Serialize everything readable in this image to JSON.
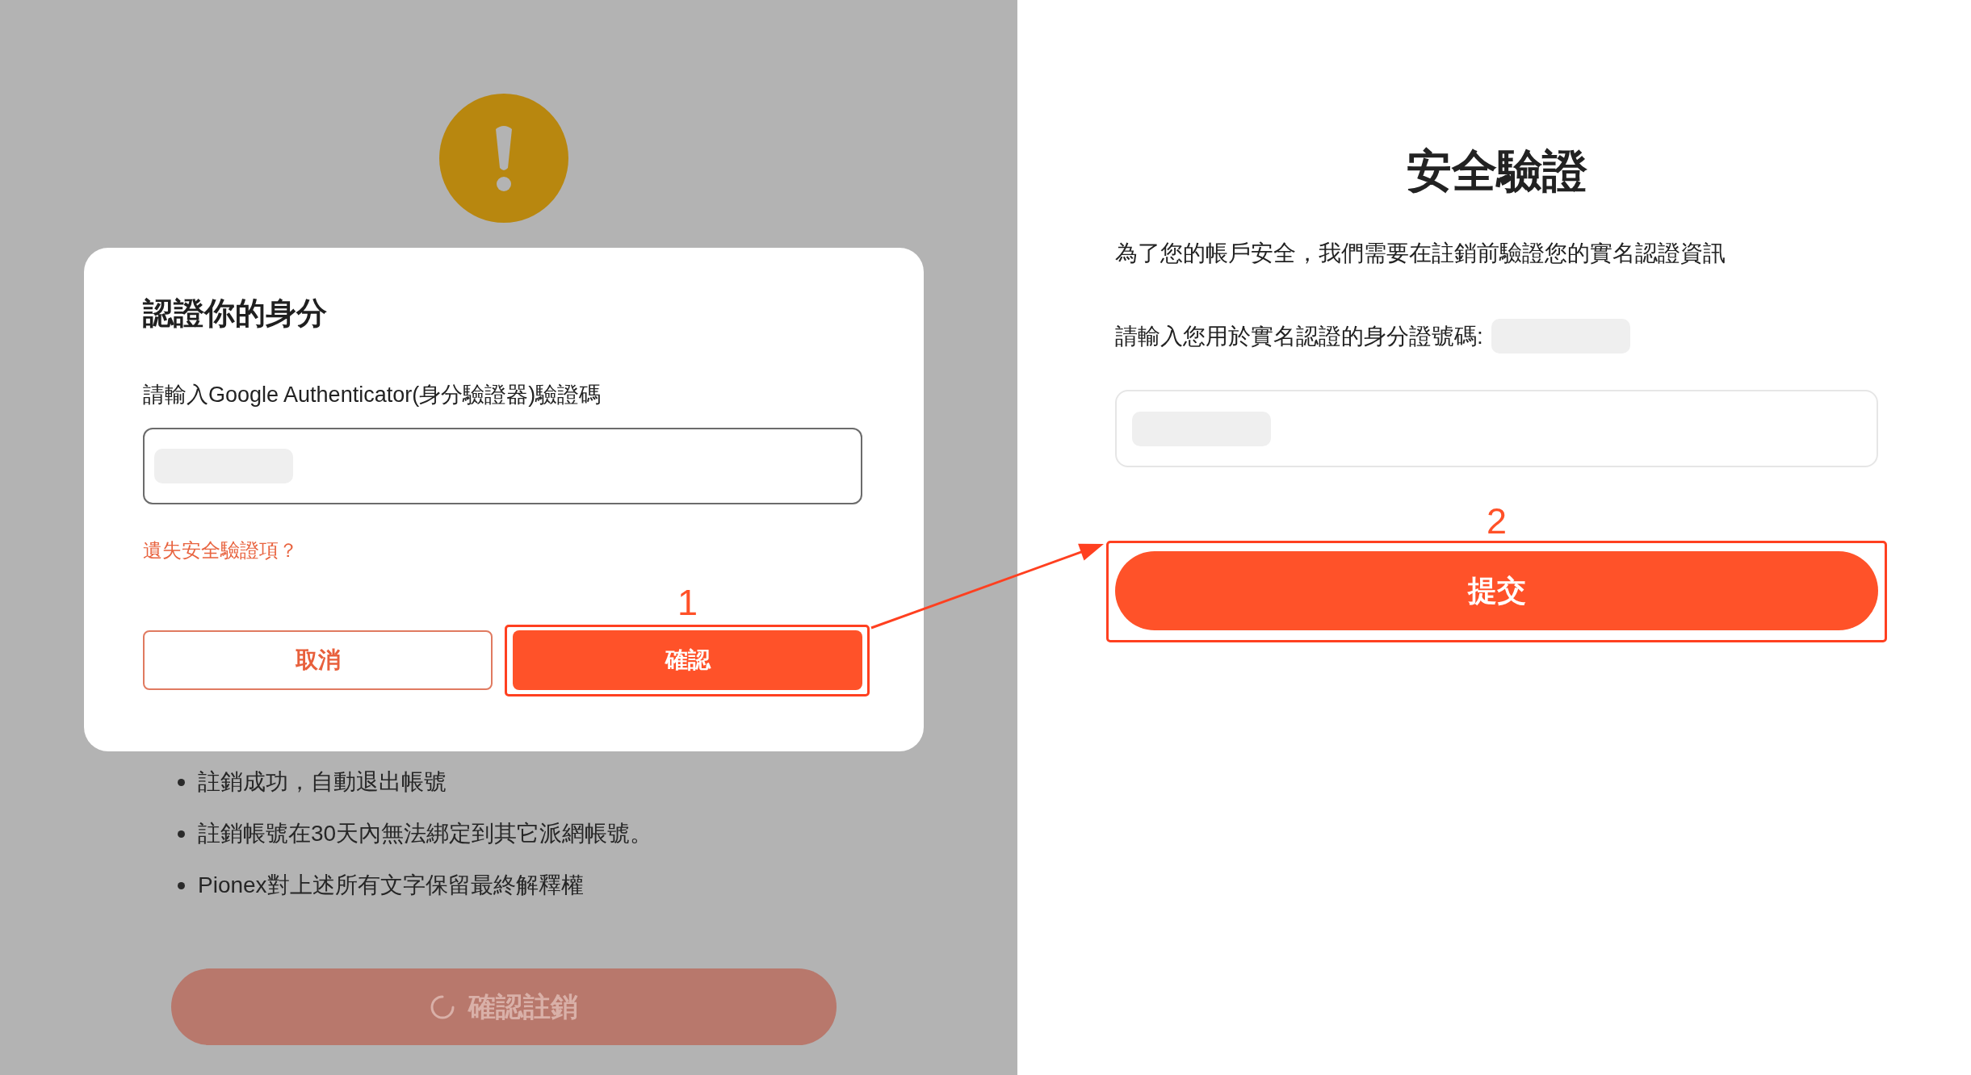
{
  "left_page": {
    "dialog": {
      "title": "認證你的身分",
      "field_label": "請輸入Google Authenticator(身分驗證器)驗證碼",
      "code_field": {
        "redacted": true
      },
      "link": "遺失安全驗證項？",
      "buttons": [
        {
          "label": "取消",
          "kind": "outline"
        },
        {
          "label": "確認",
          "kind": "filled",
          "annotation": "1"
        }
      ]
    },
    "notes": [
      "註銷成功，自動退出帳號",
      "註銷帳號在30天內無法綁定到其它派網帳號。",
      "Pionex對上述所有文字保留最終解釋權"
    ],
    "deactivate_button": {
      "label": "確認註銷",
      "disabled": true,
      "loading": true
    }
  },
  "right_page": {
    "title": "安全驗證",
    "description": "為了您的帳戶安全，我們需要在註銷前驗證您的實名認證資訊",
    "id_label": "請輸入您用於實名認證的身分證號碼:",
    "id_hint": {
      "redacted": true
    },
    "id_field": {
      "redacted": true
    },
    "submit_button": {
      "label": "提交",
      "annotation": "2"
    }
  }
}
